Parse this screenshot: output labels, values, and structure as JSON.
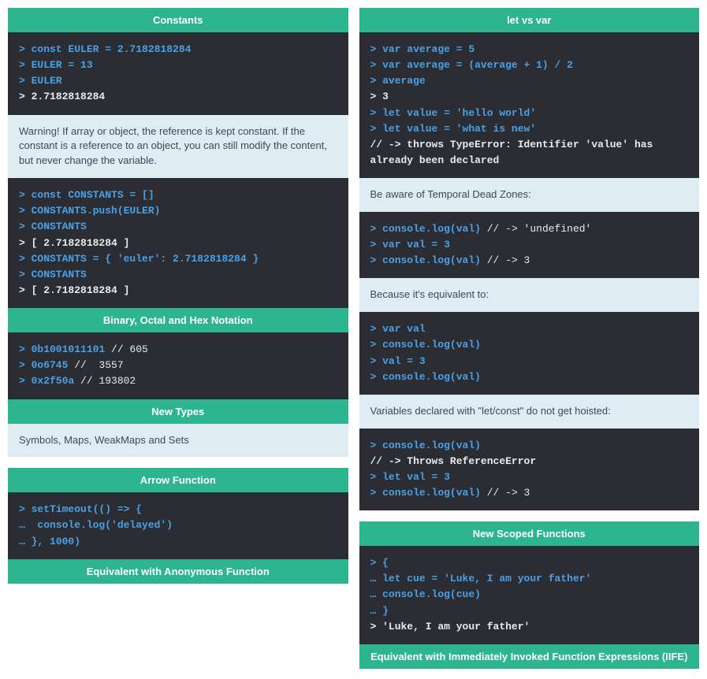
{
  "left": {
    "card1": {
      "title": "Constants",
      "code1": [
        {
          "cls": "p-blue",
          "t": "> const EULER = 2.7182818284"
        },
        {
          "cls": "p-blue",
          "t": "> EULER = 13"
        },
        {
          "cls": "p-blue",
          "t": "> EULER"
        },
        {
          "cls": "p-plain",
          "t": "> 2.7182818284"
        }
      ],
      "note1": "Warning! If array or object, the reference is kept constant. If the constant is a reference to an object, you can still modify the content, but never change the variable.",
      "code2": [
        {
          "cls": "p-blue",
          "t": "> const CONSTANTS = []"
        },
        {
          "cls": "p-blue",
          "t": "> CONSTANTS.push(EULER)"
        },
        {
          "cls": "p-blue",
          "t": "> CONSTANTS"
        },
        {
          "cls": "p-plain",
          "t": "> [ 2.7182818284 ]"
        },
        {
          "cls": "p-blue",
          "t": "> CONSTANTS = { 'euler': 2.7182818284 }"
        },
        {
          "cls": "p-blue",
          "t": "> CONSTANTS"
        },
        {
          "cls": "p-plain",
          "t": "> [ 2.7182818284 ]"
        }
      ],
      "sub1": "Binary, Octal and Hex Notation",
      "code3": [
        {
          "cls": "p-blue",
          "t": "> 0b1001011101",
          "c": " // 605"
        },
        {
          "cls": "p-blue",
          "t": "> 0o6745",
          "c": " //  3557"
        },
        {
          "cls": "p-blue",
          "t": "> 0x2f50a",
          "c": " // 193802"
        }
      ],
      "sub2": "New Types",
      "note2": "Symbols, Maps, WeakMaps and Sets"
    },
    "card2": {
      "title": "Arrow Function",
      "code1": [
        {
          "cls": "p-blue",
          "t": "> setTimeout(() => {"
        },
        {
          "cls": "p-blue",
          "t": "…  console.log('delayed')"
        },
        {
          "cls": "p-blue",
          "t": "… }, 1000)"
        }
      ],
      "sub1": "Equivalent with Anonymous Function"
    }
  },
  "right": {
    "card1": {
      "title": "let vs var",
      "code1": [
        {
          "cls": "p-blue",
          "t": "> var average = 5"
        },
        {
          "cls": "p-blue",
          "t": "> var average = (average + 1) / 2"
        },
        {
          "cls": "p-blue",
          "t": "> average"
        },
        {
          "cls": "p-plain",
          "t": "> 3"
        },
        {
          "cls": "p-blue",
          "t": "> let value = 'hello world'"
        },
        {
          "cls": "p-blue",
          "t": "> let value = 'what is new'"
        },
        {
          "cls": "p-plain",
          "t": "// -> throws TypeError: Identifier 'value' has already been declared"
        }
      ],
      "note1": "Be aware of Temporal Dead Zones:",
      "code2": [
        {
          "cls": "p-blue",
          "t": "> console.log(val)",
          "c": " // -> 'undefined'"
        },
        {
          "cls": "p-blue",
          "t": "> var val = 3"
        },
        {
          "cls": "p-blue",
          "t": "> console.log(val)",
          "c": " // -> 3"
        }
      ],
      "note2": "Because it's equivalent to:",
      "code3": [
        {
          "cls": "p-blue",
          "t": "> var val"
        },
        {
          "cls": "p-blue",
          "t": "> console.log(val)"
        },
        {
          "cls": "p-blue",
          "t": "> val = 3"
        },
        {
          "cls": "p-blue",
          "t": "> console.log(val)"
        }
      ],
      "note3": "Variables declared with \"let/const\" do not get hoisted:",
      "code4": [
        {
          "cls": "p-blue",
          "t": "> console.log(val)"
        },
        {
          "cls": "p-plain",
          "t": "// -> Throws ReferenceError"
        },
        {
          "cls": "p-blue",
          "t": "> let val = 3"
        },
        {
          "cls": "p-blue",
          "t": "> console.log(val)",
          "c": " // -> 3"
        }
      ]
    },
    "card2": {
      "title": "New Scoped Functions",
      "code1": [
        {
          "cls": "p-blue",
          "t": "> {"
        },
        {
          "cls": "p-blue",
          "t": "… let cue = 'Luke, I am your father'"
        },
        {
          "cls": "p-blue",
          "t": "… console.log(cue)"
        },
        {
          "cls": "p-blue",
          "t": "… }"
        },
        {
          "cls": "p-plain",
          "t": "> 'Luke, I am your father'"
        }
      ],
      "sub1": "Equivalent with Immediately Invoked Function Expressions (IIFE)"
    }
  }
}
